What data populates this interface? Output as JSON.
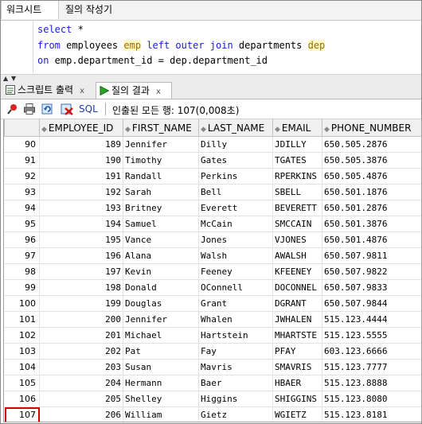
{
  "top_tabs": [
    "워크시트",
    "질의 작성기"
  ],
  "editor": {
    "line1_kw": "select",
    "line1_rest": " *",
    "line2_kw1": "from",
    "line2_t1": " employees ",
    "line2_a1": "emp",
    "line2_t2": " ",
    "line2_kw2": "left outer join",
    "line2_t3": " departments ",
    "line2_a2": "dep",
    "line3_kw": "on",
    "line3_rest": " emp.department_id = dep.department_id"
  },
  "lower_tabs": {
    "script_output": "스크립트 출력",
    "query_result": "질의 결과",
    "close": "x"
  },
  "toolbar": {
    "sql_label": "SQL",
    "status": "인출된 모든 행: 107(0,008초)"
  },
  "grid": {
    "columns": [
      "EMPLOYEE_ID",
      "FIRST_NAME",
      "LAST_NAME",
      "EMAIL",
      "PHONE_NUMBER"
    ],
    "rows": [
      {
        "rn": "90",
        "id": "189",
        "first": "Jennifer",
        "last": "Dilly",
        "email": "JDILLY",
        "phone": "650.505.2876"
      },
      {
        "rn": "91",
        "id": "190",
        "first": "Timothy",
        "last": "Gates",
        "email": "TGATES",
        "phone": "650.505.3876"
      },
      {
        "rn": "92",
        "id": "191",
        "first": "Randall",
        "last": "Perkins",
        "email": "RPERKINS",
        "phone": "650.505.4876"
      },
      {
        "rn": "93",
        "id": "192",
        "first": "Sarah",
        "last": "Bell",
        "email": "SBELL",
        "phone": "650.501.1876"
      },
      {
        "rn": "94",
        "id": "193",
        "first": "Britney",
        "last": "Everett",
        "email": "BEVERETT",
        "phone": "650.501.2876"
      },
      {
        "rn": "95",
        "id": "194",
        "first": "Samuel",
        "last": "McCain",
        "email": "SMCCAIN",
        "phone": "650.501.3876"
      },
      {
        "rn": "96",
        "id": "195",
        "first": "Vance",
        "last": "Jones",
        "email": "VJONES",
        "phone": "650.501.4876"
      },
      {
        "rn": "97",
        "id": "196",
        "first": "Alana",
        "last": "Walsh",
        "email": "AWALSH",
        "phone": "650.507.9811"
      },
      {
        "rn": "98",
        "id": "197",
        "first": "Kevin",
        "last": "Feeney",
        "email": "KFEENEY",
        "phone": "650.507.9822"
      },
      {
        "rn": "99",
        "id": "198",
        "first": "Donald",
        "last": "OConnell",
        "email": "DOCONNEL",
        "phone": "650.507.9833"
      },
      {
        "rn": "100",
        "id": "199",
        "first": "Douglas",
        "last": "Grant",
        "email": "DGRANT",
        "phone": "650.507.9844"
      },
      {
        "rn": "101",
        "id": "200",
        "first": "Jennifer",
        "last": "Whalen",
        "email": "JWHALEN",
        "phone": "515.123.4444"
      },
      {
        "rn": "102",
        "id": "201",
        "first": "Michael",
        "last": "Hartstein",
        "email": "MHARTSTE",
        "phone": "515.123.5555"
      },
      {
        "rn": "103",
        "id": "202",
        "first": "Pat",
        "last": "Fay",
        "email": "PFAY",
        "phone": "603.123.6666"
      },
      {
        "rn": "104",
        "id": "203",
        "first": "Susan",
        "last": "Mavris",
        "email": "SMAVRIS",
        "phone": "515.123.7777"
      },
      {
        "rn": "105",
        "id": "204",
        "first": "Hermann",
        "last": "Baer",
        "email": "HBAER",
        "phone": "515.123.8888"
      },
      {
        "rn": "106",
        "id": "205",
        "first": "Shelley",
        "last": "Higgins",
        "email": "SHIGGINS",
        "phone": "515.123.8080"
      },
      {
        "rn": "107",
        "id": "206",
        "first": "William",
        "last": "Gietz",
        "email": "WGIETZ",
        "phone": "515.123.8181"
      }
    ],
    "selected_row": "107"
  },
  "colors": {
    "keyword": "#1b1bd6",
    "alias_highlight": "#fffbc6",
    "selection_outline": "#d20000"
  }
}
